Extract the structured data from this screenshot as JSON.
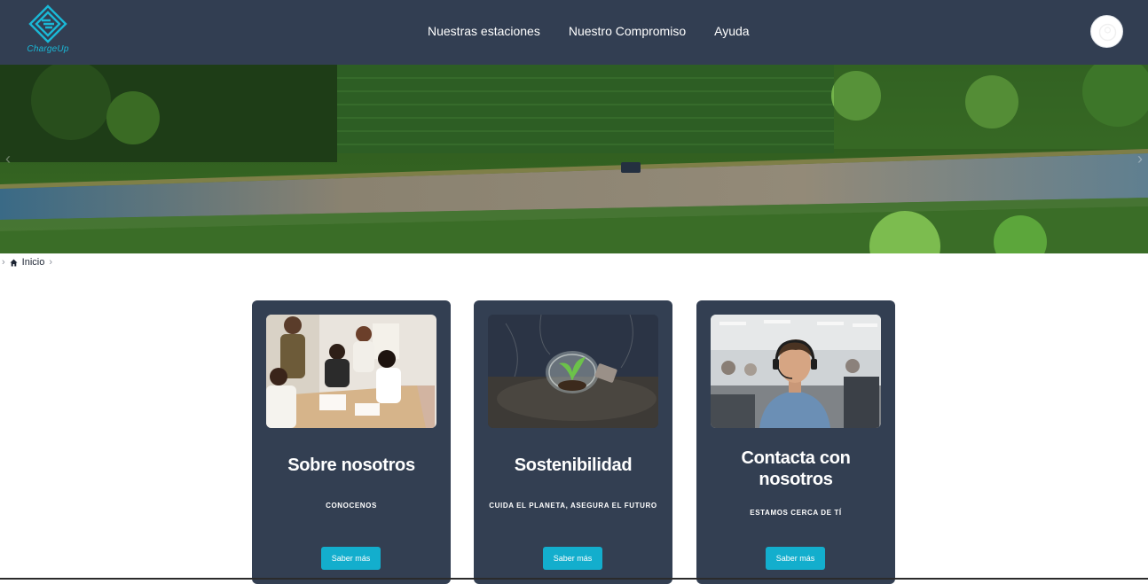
{
  "header": {
    "logo_text": "ChargeUp",
    "nav": [
      {
        "label": "Nuestras estaciones"
      },
      {
        "label": "Nuestro Compromiso"
      },
      {
        "label": "Ayuda"
      }
    ]
  },
  "breadcrumb": {
    "home_label": "Inicio"
  },
  "cards": [
    {
      "title": "Sobre nosotros",
      "subtitle": "CONOCENOS",
      "button": "Saber más"
    },
    {
      "title": "Sostenibilidad",
      "subtitle": "CUIDA EL PLANETA, ASEGURA EL FUTURO",
      "button": "Saber más"
    },
    {
      "title": "Contacta con nosotros",
      "subtitle": "ESTAMOS CERCA DE TÍ",
      "button": "Saber más"
    }
  ],
  "colors": {
    "navbar": "#323e52",
    "card": "#333f52",
    "accent": "#13aecd"
  },
  "icons": [
    "chargeup-logo-icon",
    "user-avatar-icon",
    "home-icon",
    "chevron-right-icon",
    "chevron-left-icon"
  ]
}
